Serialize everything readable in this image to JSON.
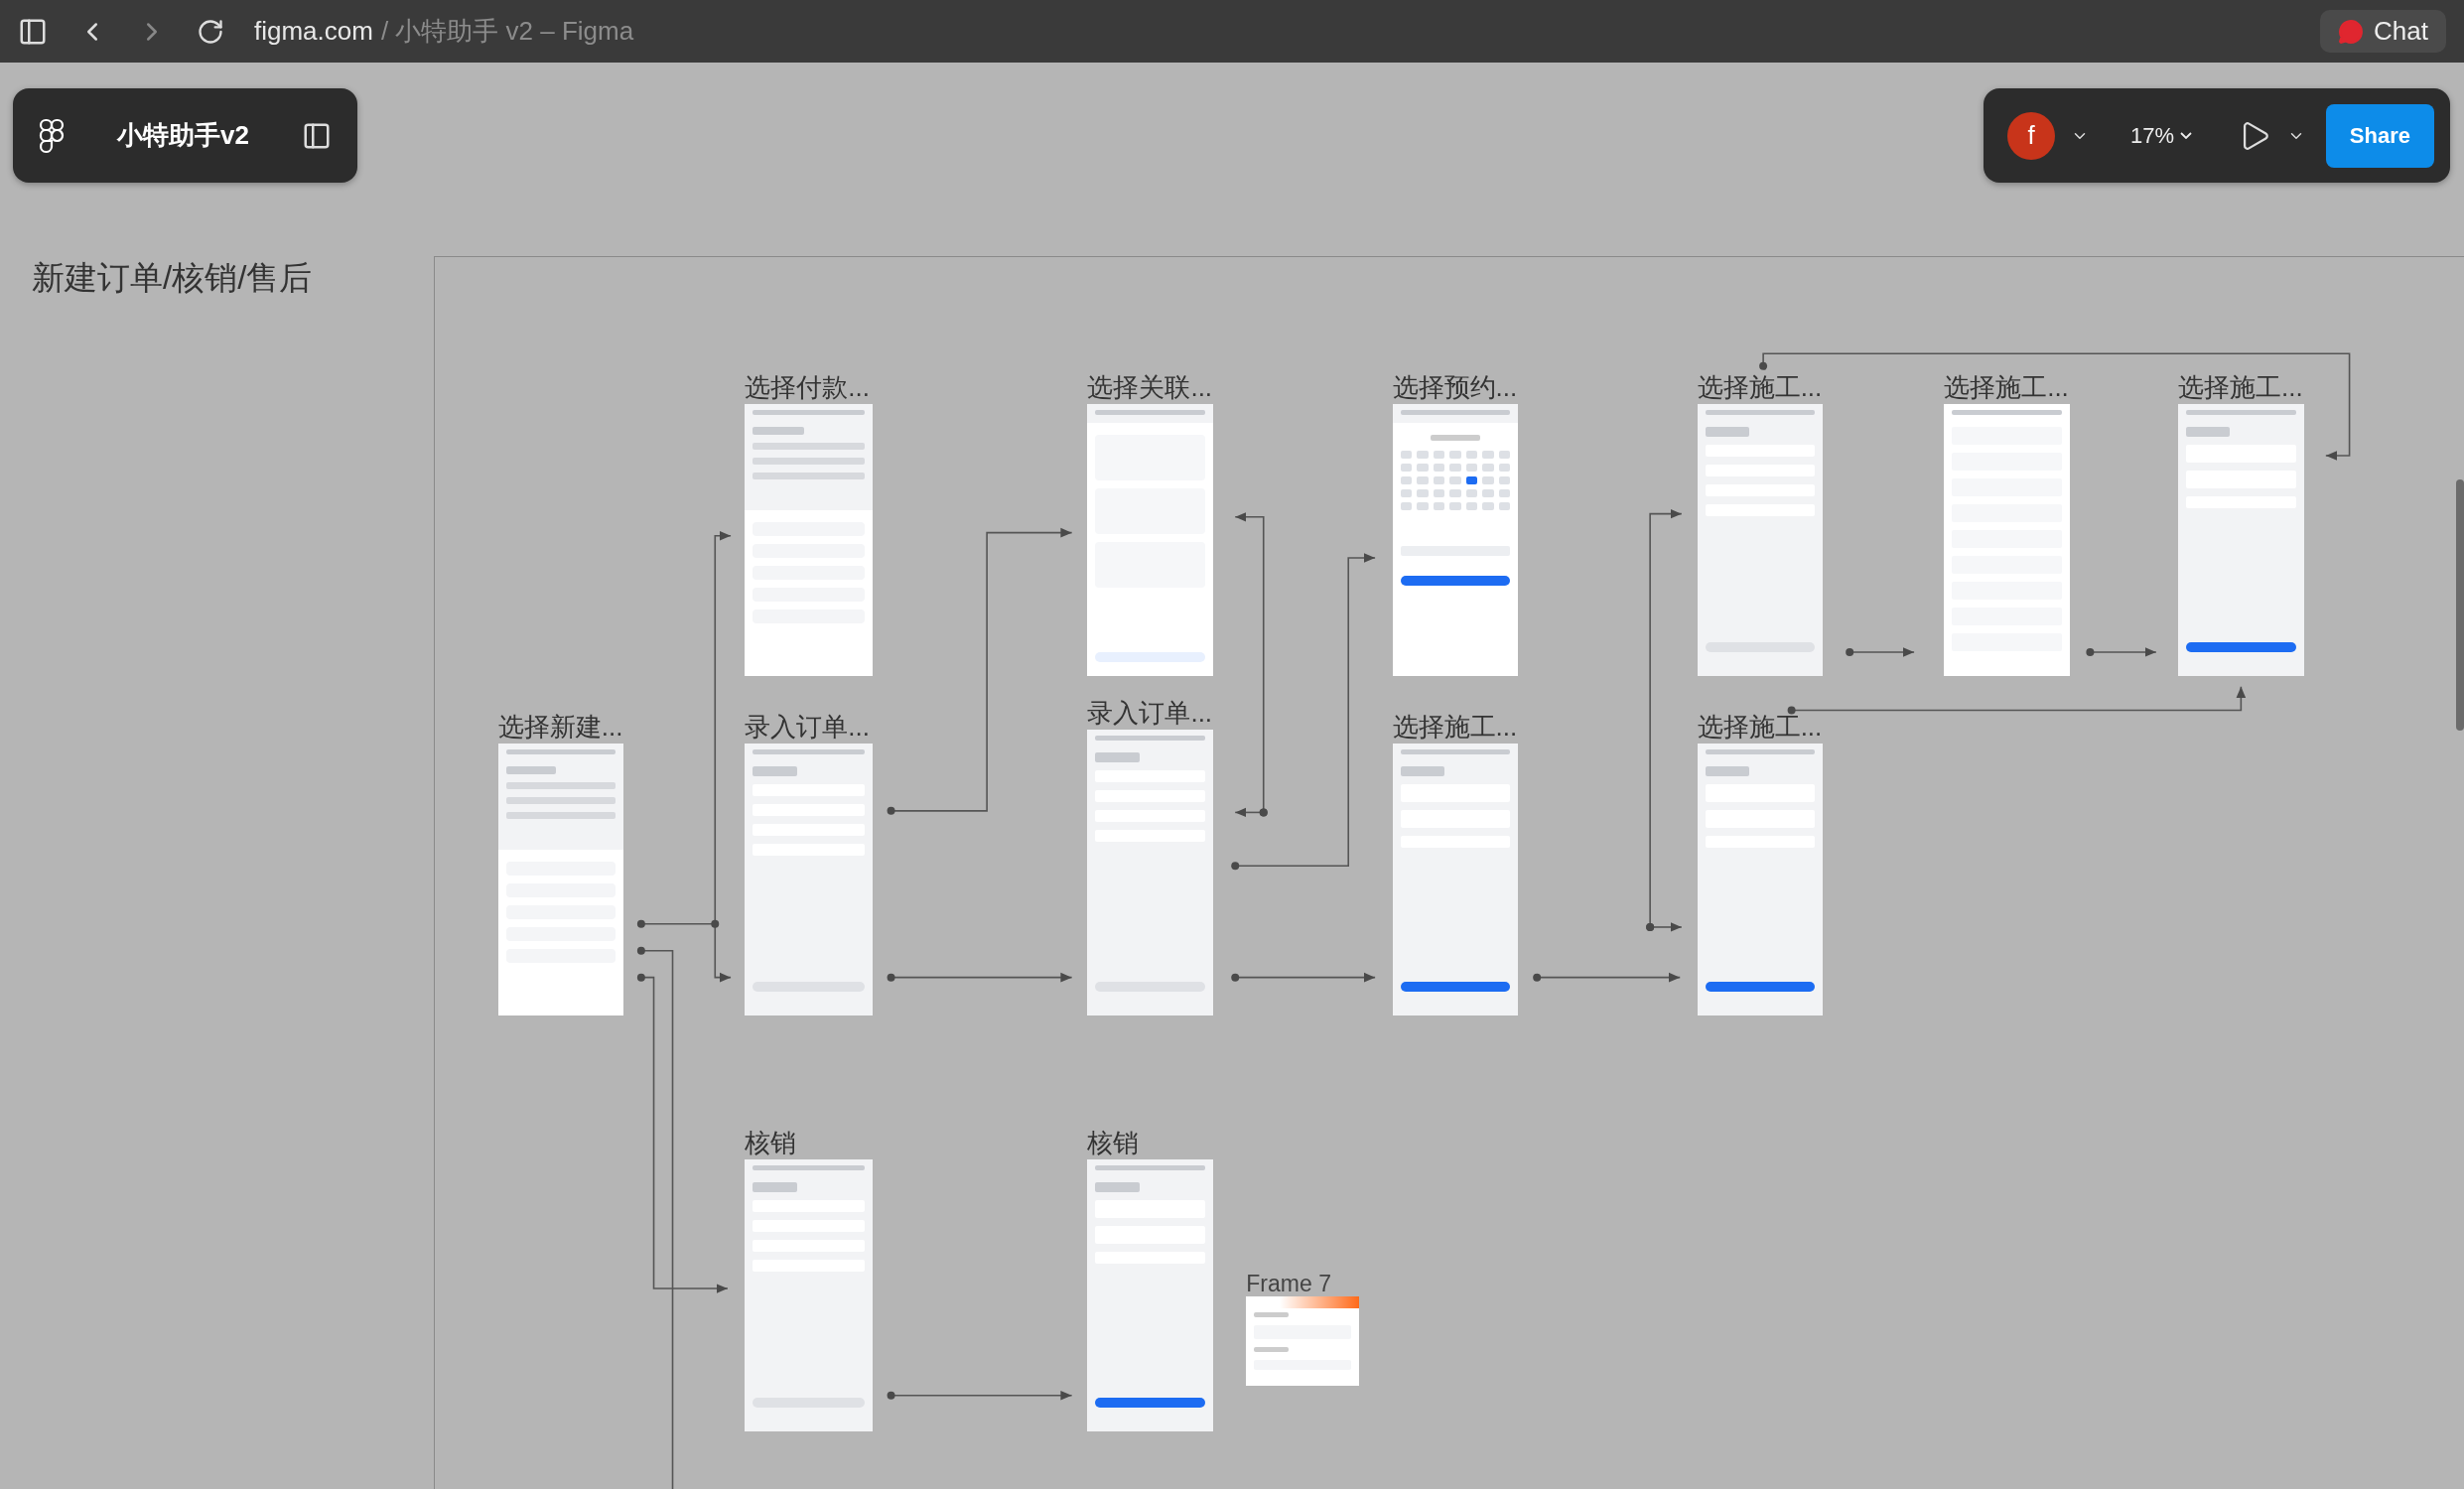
{
  "browser_bar": {
    "domain": "figma.com",
    "path": "/ 小特助手 v2 – Figma",
    "chat": "Chat"
  },
  "file_panel": {
    "file_name": "小特助手v2"
  },
  "view_panel": {
    "avatar": "f",
    "zoom": "17%",
    "share": "Share"
  },
  "section": {
    "title": "新建订单/核销/售后"
  },
  "frames": [
    {
      "label": "选择付款...",
      "kind": "sheet"
    },
    {
      "label": "选择关联...",
      "kind": "modal-list"
    },
    {
      "label": "选择预约...",
      "kind": "calendar"
    },
    {
      "label": "选择施工...",
      "kind": "form"
    },
    {
      "label": "选择施工...",
      "kind": "list"
    },
    {
      "label": "选择施工...",
      "kind": "form-blue"
    },
    {
      "label": "选择新建...",
      "kind": "sheet"
    },
    {
      "label": "录入订单...",
      "kind": "form"
    },
    {
      "label": "录入订单...",
      "kind": "form"
    },
    {
      "label": "选择施工...",
      "kind": "form-blue"
    },
    {
      "label": "选择施工...",
      "kind": "form-blue"
    },
    {
      "label": "核销",
      "kind": "form"
    },
    {
      "label": "核销",
      "kind": "form-blue"
    },
    {
      "label": "Frame 7",
      "kind": "card"
    }
  ]
}
